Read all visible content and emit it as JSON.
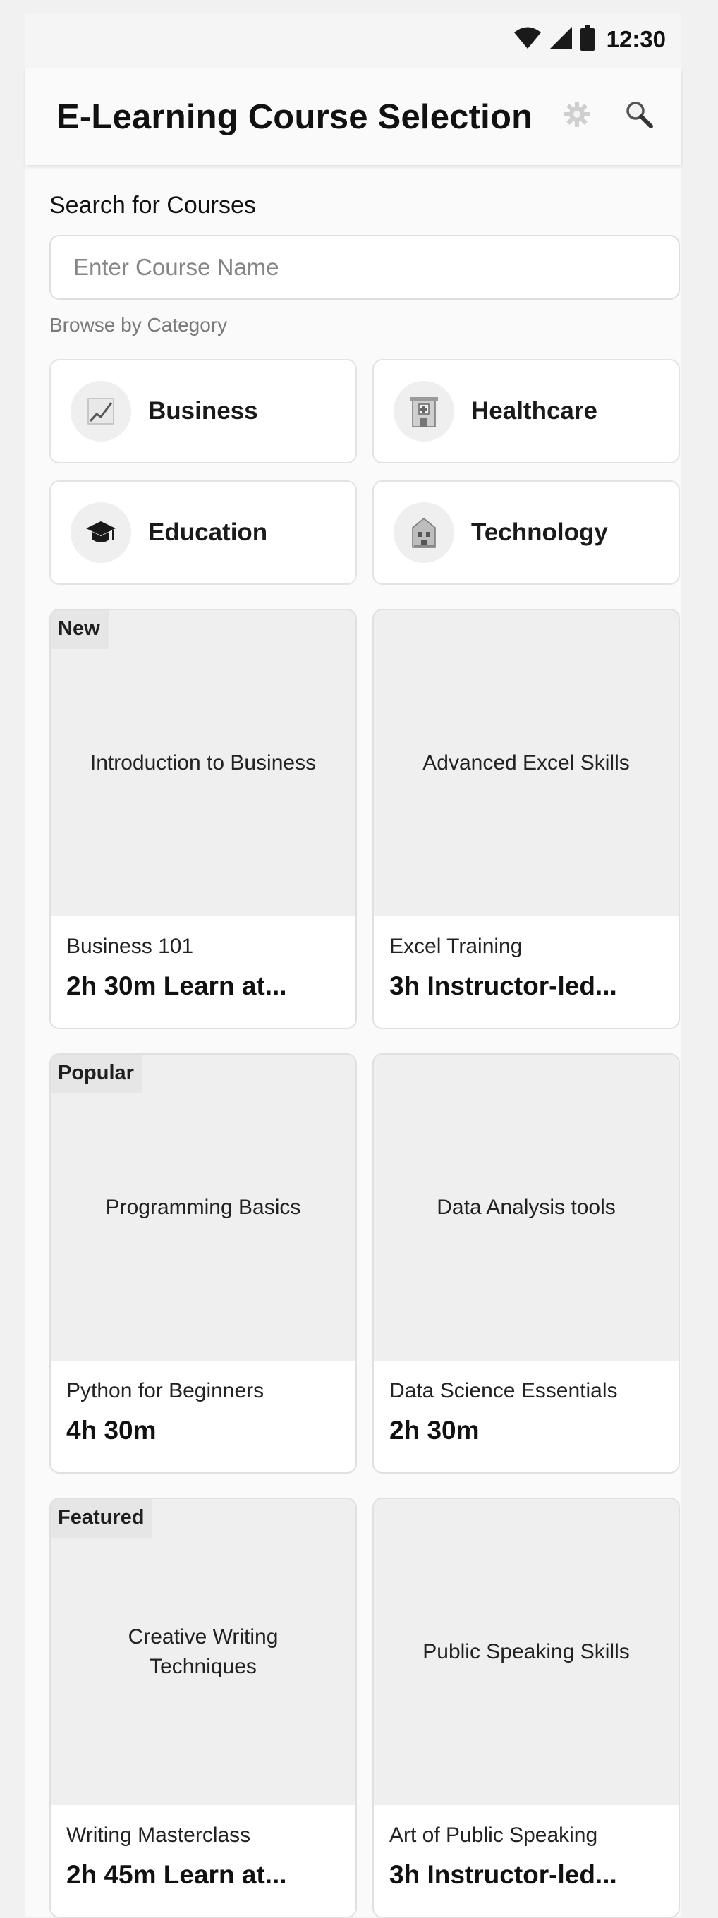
{
  "status_bar": {
    "time": "12:30",
    "icons": [
      "wifi-icon",
      "signal-icon",
      "battery-icon"
    ]
  },
  "app_bar": {
    "title": "E-Learning Course Selection",
    "actions": [
      "settings-icon",
      "search-icon"
    ]
  },
  "search": {
    "label": "Search for Courses",
    "placeholder": "Enter Course Name",
    "value": ""
  },
  "browse_label": "Browse by Category",
  "categories": [
    {
      "label": "Business",
      "icon": "chart-icon"
    },
    {
      "label": "Healthcare",
      "icon": "hospital-icon"
    },
    {
      "label": "Education",
      "icon": "graduation-cap-icon"
    },
    {
      "label": "Technology",
      "icon": "building-icon"
    }
  ],
  "courses": [
    {
      "badge": "New",
      "thumb": "Introduction to Business",
      "name": "Business 101",
      "meta": "2h 30m Learn at..."
    },
    {
      "badge": "",
      "thumb": "Advanced Excel Skills",
      "name": "Excel Training",
      "meta": "3h Instructor-led..."
    },
    {
      "badge": "Popular",
      "thumb": "Programming Basics",
      "name": "Python for Beginners",
      "meta": "4h 30m"
    },
    {
      "badge": "",
      "thumb": "Data Analysis tools",
      "name": "Data Science Essentials",
      "meta": "2h 30m"
    },
    {
      "badge": "Featured",
      "thumb": "Creative Writing Techniques",
      "name": "Writing Masterclass",
      "meta": "2h 45m Learn at..."
    },
    {
      "badge": "",
      "thumb": "Public Speaking Skills",
      "name": "Art of Public Speaking",
      "meta": "3h Instructor-led..."
    }
  ],
  "colors": {
    "background": "#f1f1f1",
    "card": "#ffffff",
    "thumb": "#efefef",
    "text": "#111111"
  }
}
